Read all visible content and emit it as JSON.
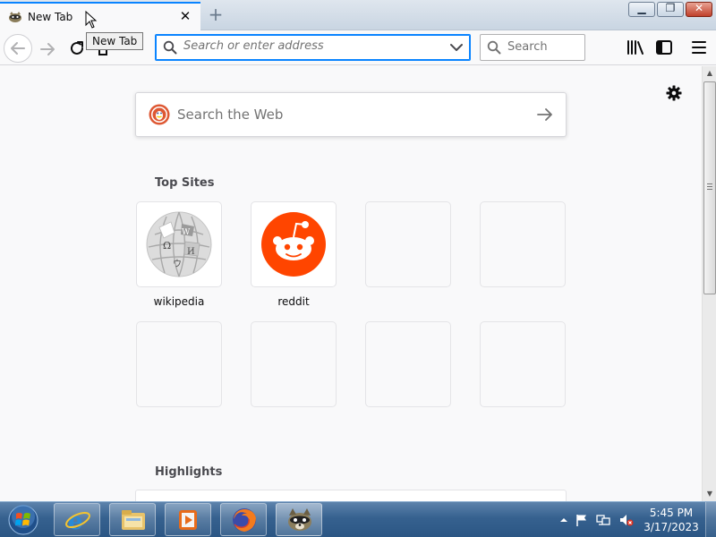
{
  "tab": {
    "title": "New Tab",
    "tooltip": "New Tab"
  },
  "navbar": {
    "url_placeholder": "Search or enter address",
    "search_placeholder": "Search"
  },
  "content": {
    "web_search_placeholder": "Search the Web",
    "top_sites_title": "Top Sites",
    "top_sites": [
      {
        "label": "wikipedia",
        "icon": "wikipedia-logo"
      },
      {
        "label": "reddit",
        "icon": "reddit-logo"
      },
      {
        "label": "",
        "icon": ""
      },
      {
        "label": "",
        "icon": ""
      },
      {
        "label": "",
        "icon": ""
      },
      {
        "label": "",
        "icon": ""
      },
      {
        "label": "",
        "icon": ""
      },
      {
        "label": "",
        "icon": ""
      }
    ],
    "highlights_title": "Highlights"
  },
  "taskbar": {
    "time": "5:45 PM",
    "date": "3/17/2023",
    "pinned": [
      "internet-explorer-icon",
      "file-explorer-icon",
      "media-player-icon",
      "firefox-icon",
      "raccoon-app-icon"
    ]
  },
  "colors": {
    "accent": "#0a84ff",
    "reddit": "#ff4500",
    "duckduckgo": "#de5833"
  }
}
